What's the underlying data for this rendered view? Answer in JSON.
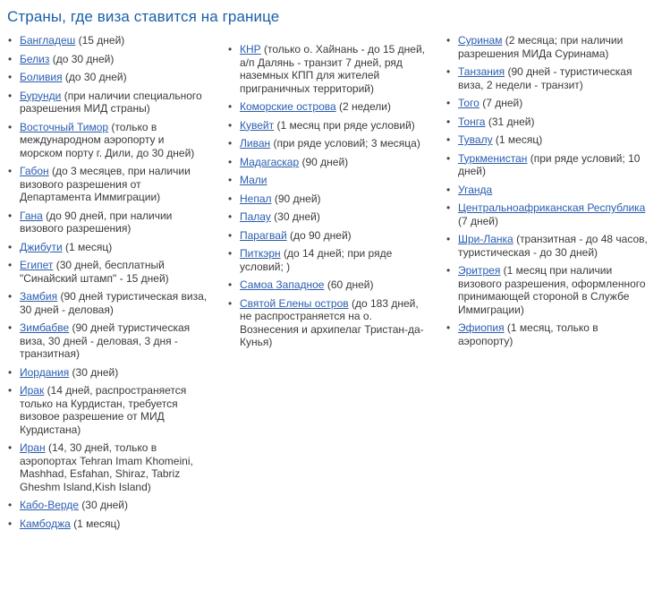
{
  "page": {
    "title": "Страны, где виза ставится на границе",
    "title_color": "#1a5fa8",
    "link_color": "#2a5db0",
    "text_color": "#3a3a3a",
    "background": "#ffffff"
  },
  "columns": [
    {
      "id": "column-1",
      "items": [
        {
          "country": "Бангладеш",
          "note": " (15 дней)"
        },
        {
          "country": "Белиз",
          "note": " (до 30 дней)"
        },
        {
          "country": "Боливия",
          "note": " (до 30 дней)"
        },
        {
          "country": "Бурунди",
          "note": " (при наличии специального разрешения МИД страны)"
        },
        {
          "country": "Восточный Тимор",
          "note": " (только в международном аэропорту и морском порту г. Дили, до 30 дней)"
        },
        {
          "country": "Габон",
          "note": " (до 3 месяцев, при наличии визового разрешения от Департамента Иммиграции)"
        },
        {
          "country": "Гана",
          "note": " (до 90 дней, при наличии визового разрешения)"
        },
        {
          "country": "Джибути",
          "note": " (1 месяц)"
        },
        {
          "country": "Египет",
          "note": " (30 дней, бесплатный \"Синайский штамп\" - 15 дней)"
        },
        {
          "country": "Замбия",
          "note": " (90 дней туристическая виза, 30 дней - деловая)"
        },
        {
          "country": "Зимбабве",
          "note": " (90 дней туристическая виза, 30 дней - деловая, 3 дня - транзитная)"
        },
        {
          "country": "Иордания",
          "note": " (30 дней)"
        },
        {
          "country": "Ирак",
          "note": " (14 дней, распространяется только на Курдистан, требуется визовое разрешение от МИД Курдистана)"
        },
        {
          "country": "Иран",
          "note": " (14, 30 дней, только в аэропортах Tehran Imam Khomeini, Mashhad, Esfahan, Shiraz, Tabriz Gheshm Island,Kish Island)"
        },
        {
          "country": "Кабо-Верде",
          "note": " (30 дней)"
        },
        {
          "country": "Камбоджа",
          "note": " (1 месяц)"
        }
      ]
    },
    {
      "id": "column-2",
      "items": [
        {
          "country": "КНР",
          "note": " (только о. Хайнань - до 15 дней, а/п Далянь - транзит 7 дней, ряд наземных КПП для жителей приграничных территорий)"
        },
        {
          "country": "Коморские острова",
          "note": " (2 недели)"
        },
        {
          "country": "Кувейт",
          "note": " (1 месяц при ряде условий)"
        },
        {
          "country": "Ливан",
          "note": " (при ряде условий; 3 месяца)"
        },
        {
          "country": "Мадагаскар",
          "note": " (90 дней)"
        },
        {
          "country": "Мали",
          "note": ""
        },
        {
          "country": "Непал",
          "note": " (90 дней)"
        },
        {
          "country": "Палау",
          "note": " (30 дней)"
        },
        {
          "country": "Парагвай",
          "note": " (до 90 дней)"
        },
        {
          "country": "Питкэрн",
          "note": " (до 14 дней; при ряде условий; )"
        },
        {
          "country": "Самоа Западное",
          "note": " (60 дней)"
        },
        {
          "country": "Святой Елены остров",
          "note": " (до 183 дней, не распространяется на о. Вознесения и архипелаг Тристан-да-Кунья)"
        }
      ]
    },
    {
      "id": "column-3",
      "items": [
        {
          "country": "Суринам",
          "note": " (2 месяца; при наличии разрешения МИДа Суринама)"
        },
        {
          "country": "Танзания",
          "note": " (90 дней - туристическая виза, 2 недели - транзит)"
        },
        {
          "country": "Того",
          "note": " (7 дней)"
        },
        {
          "country": "Тонга",
          "note": " (31 дней)"
        },
        {
          "country": "Тувалу",
          "note": " (1 месяц)"
        },
        {
          "country": "Туркменистан",
          "note": " (при ряде условий; 10 дней)"
        },
        {
          "country": "Уганда",
          "note": ""
        },
        {
          "country": "Центральноафриканская Республика",
          "note": " (7 дней)"
        },
        {
          "country": "Шри-Ланка",
          "note": " (транзитная - до 48 часов, туристическая - до 30 дней)"
        },
        {
          "country": "Эритрея",
          "note": " (1 месяц при наличии визового разрешения, оформленного принимающей стороной в Службе Иммиграции)"
        },
        {
          "country": "Эфиопия",
          "note": " (1 месяц, только в аэропорту)"
        }
      ]
    }
  ]
}
